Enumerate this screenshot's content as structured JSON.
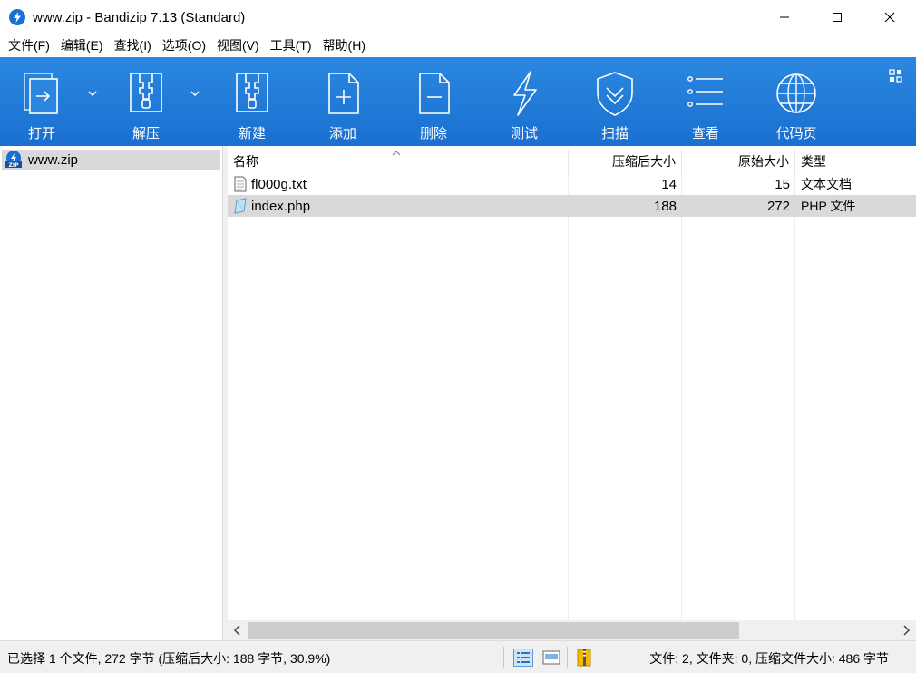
{
  "window": {
    "title": "www.zip - Bandizip 7.13 (Standard)"
  },
  "menu": [
    "文件(F)",
    "编辑(E)",
    "查找(I)",
    "选项(O)",
    "视图(V)",
    "工具(T)",
    "帮助(H)"
  ],
  "toolbar": {
    "open": "打开",
    "extract": "解压",
    "new": "新建",
    "add": "添加",
    "delete": "删除",
    "test": "测试",
    "scan": "扫描",
    "view": "查看",
    "codepage": "代码页"
  },
  "tree": {
    "root": "www.zip"
  },
  "columns": {
    "name": "名称",
    "compressed": "压缩后大小",
    "original": "原始大小",
    "type": "类型"
  },
  "files": [
    {
      "name": "fl000g.txt",
      "compressed": "14",
      "original": "15",
      "type": "文本文档",
      "selected": false
    },
    {
      "name": "index.php",
      "compressed": "188",
      "original": "272",
      "type": "PHP 文件",
      "selected": true
    }
  ],
  "status": {
    "left": "已选择 1 个文件, 272 字节 (压缩后大小: 188 字节, 30.9%)",
    "right": "文件: 2, 文件夹: 0, 压缩文件大小: 486 字节"
  },
  "colors": {
    "toolbar": "#1e7ad8",
    "selection": "#d9d9d9"
  }
}
